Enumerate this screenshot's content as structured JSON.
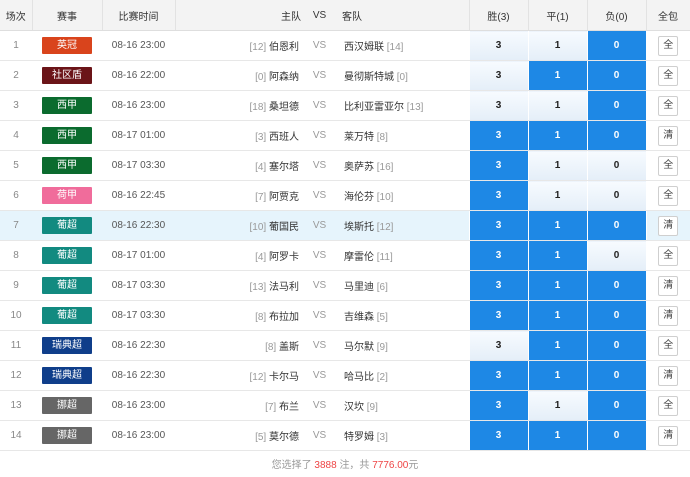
{
  "headers": {
    "num": "场次",
    "league": "赛事",
    "time": "比赛时间",
    "home": "主队",
    "vs": "VS",
    "away": "客队",
    "win": "胜(3)",
    "draw": "平(1)",
    "lose": "负(0)",
    "all": "全包"
  },
  "colors": {
    "selected": "#1e88e5",
    "highlight_row": "#e6f4fc",
    "summary_red": "#e44444"
  },
  "rows": [
    {
      "num": "1",
      "league": "英冠",
      "league_color": "#d9441c",
      "time": "08-16 23:00",
      "home_rank": "[12]",
      "home": "伯恩利",
      "vs": "VS",
      "away": "西汉姆联",
      "away_rank": "[14]",
      "win": "3",
      "draw": "1",
      "lose": "0",
      "sel": [
        false,
        false,
        true
      ],
      "btn": "全",
      "highlight": false
    },
    {
      "num": "2",
      "league": "社区盾",
      "league_color": "#6b1418",
      "time": "08-16 22:00",
      "home_rank": "[0]",
      "home": "阿森纳",
      "vs": "VS",
      "away": "曼彻斯特城",
      "away_rank": "[0]",
      "win": "3",
      "draw": "1",
      "lose": "0",
      "sel": [
        false,
        true,
        true
      ],
      "btn": "全",
      "highlight": false
    },
    {
      "num": "3",
      "league": "西甲",
      "league_color": "#0b6b2e",
      "time": "08-16 23:00",
      "home_rank": "[18]",
      "home": "桑坦德",
      "vs": "VS",
      "away": "比利亚雷亚尔",
      "away_rank": "[13]",
      "win": "3",
      "draw": "1",
      "lose": "0",
      "sel": [
        false,
        false,
        true
      ],
      "btn": "全",
      "highlight": false
    },
    {
      "num": "4",
      "league": "西甲",
      "league_color": "#0b6b2e",
      "time": "08-17 01:00",
      "home_rank": "[3]",
      "home": "西班人",
      "vs": "VS",
      "away": "莱万特",
      "away_rank": "[8]",
      "win": "3",
      "draw": "1",
      "lose": "0",
      "sel": [
        true,
        true,
        true
      ],
      "btn": "清",
      "highlight": false
    },
    {
      "num": "5",
      "league": "西甲",
      "league_color": "#0b6b2e",
      "time": "08-17 03:30",
      "home_rank": "[4]",
      "home": "塞尔塔",
      "vs": "VS",
      "away": "奥萨苏",
      "away_rank": "[16]",
      "win": "3",
      "draw": "1",
      "lose": "0",
      "sel": [
        true,
        false,
        false
      ],
      "btn": "全",
      "highlight": false
    },
    {
      "num": "6",
      "league": "荷甲",
      "league_color": "#f06c9b",
      "time": "08-16 22:45",
      "home_rank": "[7]",
      "home": "阿贾克",
      "vs": "VS",
      "away": "海伦芬",
      "away_rank": "[10]",
      "win": "3",
      "draw": "1",
      "lose": "0",
      "sel": [
        true,
        false,
        false
      ],
      "btn": "全",
      "highlight": false
    },
    {
      "num": "7",
      "league": "葡超",
      "league_color": "#128a80",
      "time": "08-16 22:30",
      "home_rank": "[10]",
      "home": "葡国民",
      "vs": "VS",
      "away": "埃斯托",
      "away_rank": "[12]",
      "win": "3",
      "draw": "1",
      "lose": "0",
      "sel": [
        true,
        true,
        true
      ],
      "btn": "清",
      "highlight": true
    },
    {
      "num": "8",
      "league": "葡超",
      "league_color": "#128a80",
      "time": "08-17 01:00",
      "home_rank": "[4]",
      "home": "阿罗卡",
      "vs": "VS",
      "away": "摩雷伦",
      "away_rank": "[11]",
      "win": "3",
      "draw": "1",
      "lose": "0",
      "sel": [
        true,
        true,
        false
      ],
      "btn": "全",
      "highlight": false
    },
    {
      "num": "9",
      "league": "葡超",
      "league_color": "#128a80",
      "time": "08-17 03:30",
      "home_rank": "[13]",
      "home": "法马利",
      "vs": "VS",
      "away": "马里迪",
      "away_rank": "[6]",
      "win": "3",
      "draw": "1",
      "lose": "0",
      "sel": [
        true,
        true,
        true
      ],
      "btn": "清",
      "highlight": false
    },
    {
      "num": "10",
      "league": "葡超",
      "league_color": "#128a80",
      "time": "08-17 03:30",
      "home_rank": "[8]",
      "home": "布拉加",
      "vs": "VS",
      "away": "吉维森",
      "away_rank": "[5]",
      "win": "3",
      "draw": "1",
      "lose": "0",
      "sel": [
        true,
        true,
        true
      ],
      "btn": "清",
      "highlight": false
    },
    {
      "num": "11",
      "league": "瑞典超",
      "league_color": "#0f3e8a",
      "time": "08-16 22:30",
      "home_rank": "[8]",
      "home": "盖斯",
      "vs": "VS",
      "away": "马尔默",
      "away_rank": "[9]",
      "win": "3",
      "draw": "1",
      "lose": "0",
      "sel": [
        false,
        true,
        true
      ],
      "btn": "全",
      "highlight": false
    },
    {
      "num": "12",
      "league": "瑞典超",
      "league_color": "#0f3e8a",
      "time": "08-16 22:30",
      "home_rank": "[12]",
      "home": "卡尔马",
      "vs": "VS",
      "away": "哈马比",
      "away_rank": "[2]",
      "win": "3",
      "draw": "1",
      "lose": "0",
      "sel": [
        true,
        true,
        true
      ],
      "btn": "清",
      "highlight": false
    },
    {
      "num": "13",
      "league": "挪超",
      "league_color": "#666666",
      "time": "08-16 23:00",
      "home_rank": "[7]",
      "home": "布兰",
      "vs": "VS",
      "away": "汉坎",
      "away_rank": "[9]",
      "win": "3",
      "draw": "1",
      "lose": "0",
      "sel": [
        true,
        false,
        true
      ],
      "btn": "全",
      "highlight": false
    },
    {
      "num": "14",
      "league": "挪超",
      "league_color": "#666666",
      "time": "08-16 23:00",
      "home_rank": "[5]",
      "home": "莫尔德",
      "vs": "VS",
      "away": "特罗姆",
      "away_rank": "[3]",
      "win": "3",
      "draw": "1",
      "lose": "0",
      "sel": [
        true,
        true,
        true
      ],
      "btn": "清",
      "highlight": false
    }
  ],
  "summary": {
    "prefix": "您选择了",
    "count": "3888",
    "mid": "注，共",
    "amount": "7776.00",
    "suffix": "元"
  }
}
